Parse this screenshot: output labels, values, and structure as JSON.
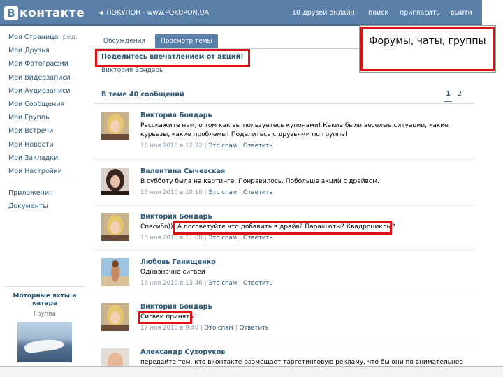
{
  "header": {
    "logo_letter": "B",
    "logo_text": "контакте",
    "back_arrow": "◄",
    "back_text": "ПОКУПОН - www.POKUPON.UA",
    "friends_online": "10 друзей онлайн",
    "search": "поиск",
    "invite": "пригласить",
    "logout": "выйти"
  },
  "nav": {
    "items": [
      "Моя Страница",
      "Мои Друзья",
      "Мои Фотографии",
      "Мои Видеозаписи",
      "Мои Аудиозаписи",
      "Мои Сообщения",
      "Мои Группы",
      "Мои Встречи",
      "Мои Новости",
      "Мои Закладки",
      "Мои Настройки"
    ],
    "edit": "ред.",
    "apps": "Приложения",
    "docs": "Документы"
  },
  "ad": {
    "title": "Моторные яхты и катера",
    "subtitle": "Группа"
  },
  "tabs": [
    "Обсуждения",
    "Просмотр темы"
  ],
  "topic": {
    "title": "Поделитесь впечатлением от акций!",
    "author": "Виктория Бондарь"
  },
  "count": "В теме 40 сообщений",
  "pager": [
    "1",
    "2"
  ],
  "callout": "Форумы, чаты, группы",
  "meta_links": {
    "spam": "Это спам",
    "reply": "Ответить",
    "sep": "|"
  },
  "posts": [
    {
      "name": "Виктория Бондарь",
      "text": "Расскажите нам, о том как вы пользуетесь купонами! Какие были веселые ситуации, какие курьезы, какие проблемы! Поделитесь с друзьями по группе!",
      "date": "16 ноя 2010 в 12:22",
      "avatar": "blonde-woman"
    },
    {
      "name": "Валентина Сычевская",
      "text": "В субботу была на картинге. Понравилось. Побольше акций с драйвом.",
      "date": "16 ноя 2010 в 10:10",
      "avatar": "dark-hair-woman"
    },
    {
      "name": "Виктория Бондарь",
      "text": "Спасибо))) А посоветуйте что добавить в драйв? Парашюты? Квадроциклы?",
      "date": "16 ноя 2010 в 11:08",
      "avatar": "blonde-woman"
    },
    {
      "name": "Любовь Ганищенко",
      "text": "Однозначно сигвеи",
      "date": "16 ноя 2010 в 13:46",
      "avatar": "beach-woman"
    },
    {
      "name": "Виктория Бондарь",
      "text": "Сигвеи приняты!",
      "date": "17 ноя 2010 в 9:40",
      "avatar": "blonde-woman"
    },
    {
      "name": "Александр Сухоруков",
      "text": "передайте тем, кто вконтакте размещает таргетинговую рекламу, что бы они по внимательнее",
      "date": "",
      "avatar": "bald-man"
    }
  ],
  "colors": {
    "accent": "#5a7fa8",
    "link": "#2b587a",
    "highlight": "#dd1111"
  }
}
